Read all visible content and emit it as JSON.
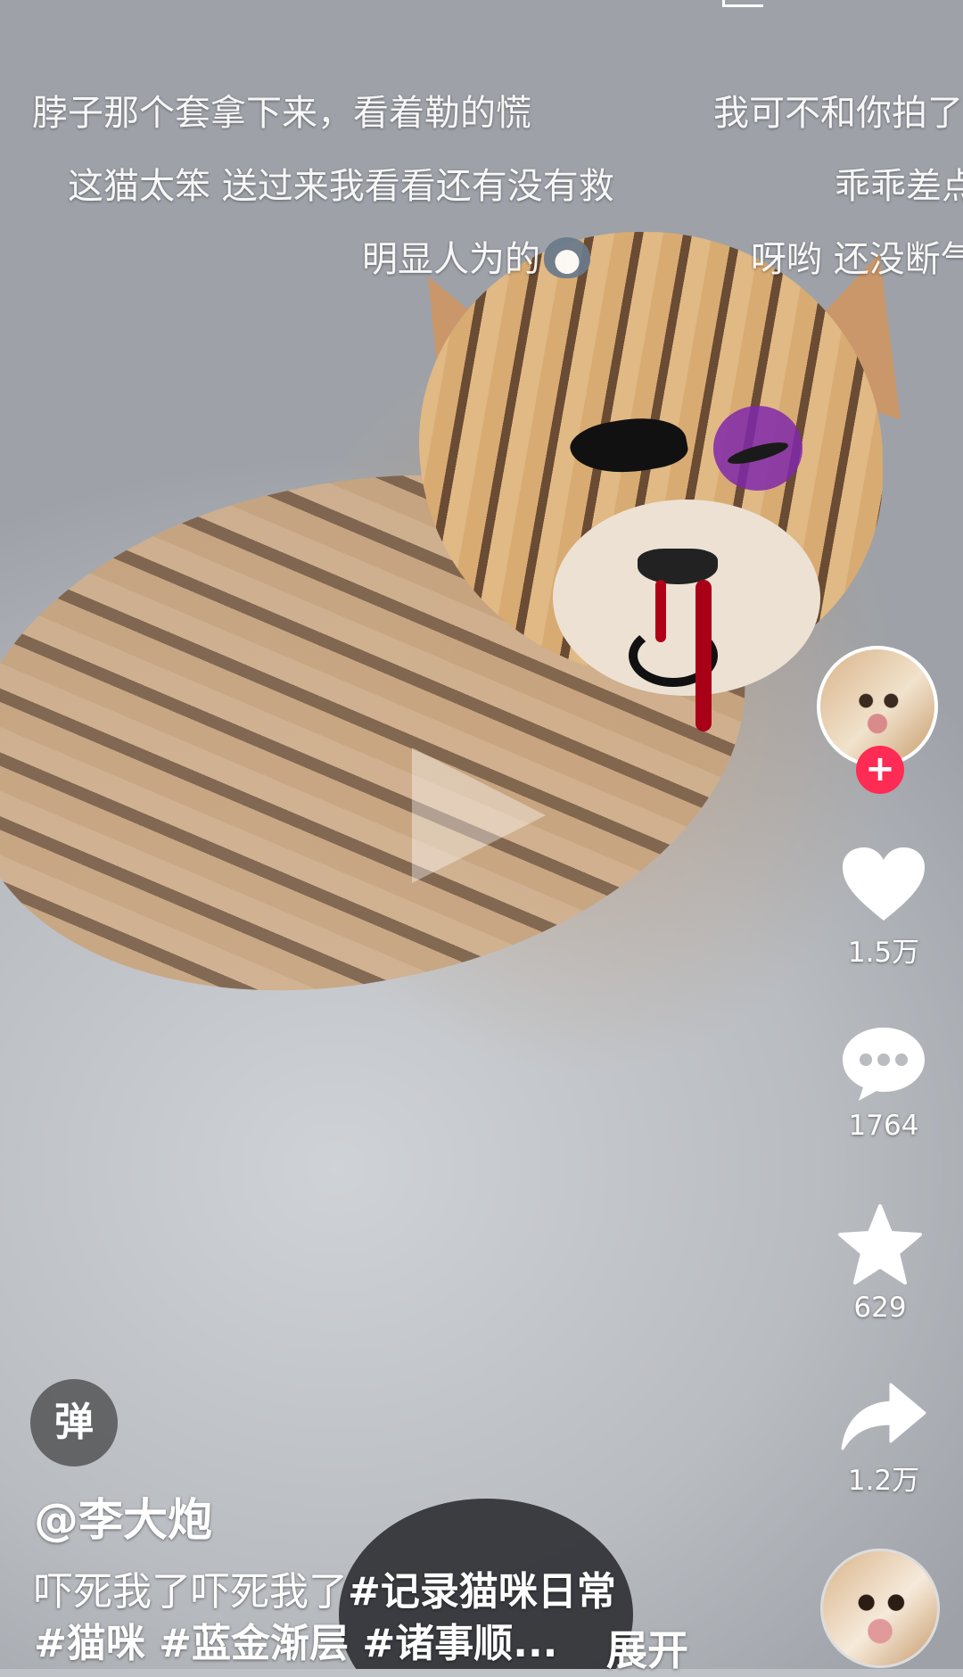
{
  "danmaku": [
    {
      "text": "脖子那个套拿下来，看着勒的慌"
    },
    {
      "text": "我可不和你拍了"
    },
    {
      "text": "这猫太笨 送过来我看看还有没有救"
    },
    {
      "text": "乖乖差点"
    },
    {
      "text": "明显人为的"
    },
    {
      "text": "呀哟 还没断气"
    }
  ],
  "emoji_icon": "wolf-face-emoji",
  "actions": {
    "like_count": "1.5万",
    "comment_count": "1764",
    "favorite_count": "629",
    "share_count": "1.2万"
  },
  "danmu_toggle_label": "弹",
  "author": "@李大炮",
  "caption": {
    "text": "吓死我了吓死我了",
    "tag1": "#记录猫咪日常",
    "line2": "#猫咪 #蓝金渐层 #诸事顺...",
    "expand_label": "展开"
  },
  "colors": {
    "follow_plus": "#fe2c55",
    "icon": "#ffffff"
  }
}
